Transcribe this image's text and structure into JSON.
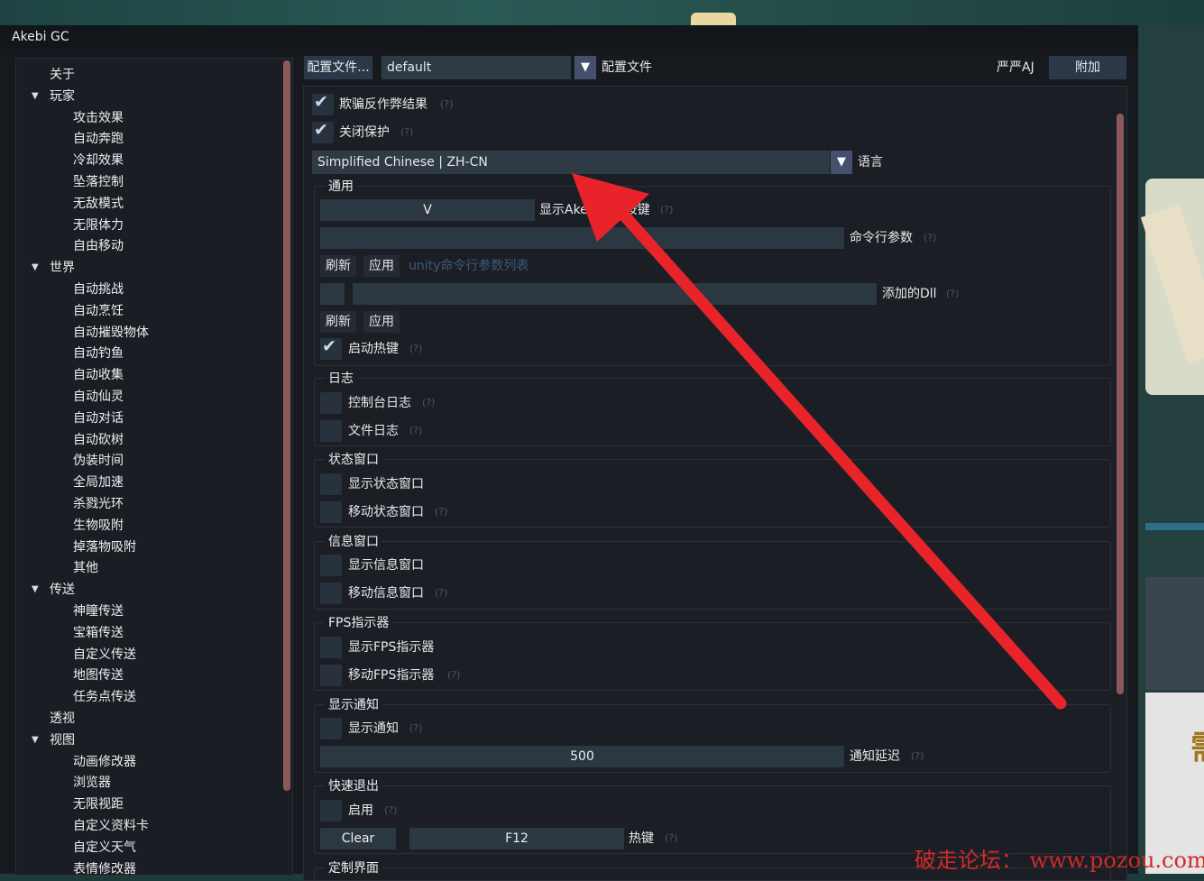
{
  "window": {
    "title": "Akebi GC"
  },
  "sidebar": {
    "items": [
      {
        "label": "关于",
        "level": 0,
        "expandable": false
      },
      {
        "label": "玩家",
        "level": 0,
        "expandable": true
      },
      {
        "label": "攻击效果",
        "level": 1
      },
      {
        "label": "自动奔跑",
        "level": 1
      },
      {
        "label": "冷却效果",
        "level": 1
      },
      {
        "label": "坠落控制",
        "level": 1
      },
      {
        "label": "无敌模式",
        "level": 1
      },
      {
        "label": "无限体力",
        "level": 1
      },
      {
        "label": "自由移动",
        "level": 1
      },
      {
        "label": "世界",
        "level": 0,
        "expandable": true
      },
      {
        "label": "自动挑战",
        "level": 1
      },
      {
        "label": "自动烹饪",
        "level": 1
      },
      {
        "label": "自动摧毁物体",
        "level": 1
      },
      {
        "label": "自动钓鱼",
        "level": 1
      },
      {
        "label": "自动收集",
        "level": 1
      },
      {
        "label": "自动仙灵",
        "level": 1
      },
      {
        "label": "自动对话",
        "level": 1
      },
      {
        "label": "自动砍树",
        "level": 1
      },
      {
        "label": "伪装时间",
        "level": 1
      },
      {
        "label": "全局加速",
        "level": 1
      },
      {
        "label": "杀戮光环",
        "level": 1
      },
      {
        "label": "生物吸附",
        "level": 1
      },
      {
        "label": "掉落物吸附",
        "level": 1
      },
      {
        "label": "其他",
        "level": 1
      },
      {
        "label": "传送",
        "level": 0,
        "expandable": true
      },
      {
        "label": "神瞳传送",
        "level": 1
      },
      {
        "label": "宝箱传送",
        "level": 1
      },
      {
        "label": "自定义传送",
        "level": 1
      },
      {
        "label": "地图传送",
        "level": 1
      },
      {
        "label": "任务点传送",
        "level": 1
      },
      {
        "label": "透视",
        "level": 0,
        "expandable": false
      },
      {
        "label": "视图",
        "level": 0,
        "expandable": true
      },
      {
        "label": "动画修改器",
        "level": 1
      },
      {
        "label": "浏览器",
        "level": 1
      },
      {
        "label": "无限视距",
        "level": 1
      },
      {
        "label": "自定义资料卡",
        "level": 1
      },
      {
        "label": "自定义天气",
        "level": 1
      },
      {
        "label": "表情修改器",
        "level": 1
      }
    ]
  },
  "toolbar": {
    "profile_button": "配置文件...",
    "profile_value": "default",
    "profile_label": "配置文件",
    "user_label": "严严AJ",
    "attach_button": "附加"
  },
  "settings": {
    "help": "(?)",
    "checked_mark": "✔",
    "arrow_glyph": "▼",
    "spoof_ac": {
      "label": "欺骗反作弊结果",
      "checked": true
    },
    "disable_protection": {
      "label": "关闭保护",
      "checked": true
    },
    "language": {
      "value": "Simplified Chinese | ZH-CN",
      "label": "语言"
    },
    "general": {
      "title": "通用",
      "hotkey_value": "V",
      "hotkey_label": "显示Akebi菜单按键",
      "cmdline_label": "命令行参数",
      "refresh": "刷新",
      "apply": "应用",
      "unity_hint": "unity命令行参数列表",
      "dll_label": "添加的Dll",
      "enable_hotkeys": {
        "label": "启动热键",
        "checked": true
      }
    },
    "logging": {
      "title": "日志",
      "console": "控制台日志",
      "file": "文件日志"
    },
    "status_window": {
      "title": "状态窗口",
      "show": "显示状态窗口",
      "move": "移动状态窗口"
    },
    "info_window": {
      "title": "信息窗口",
      "show": "显示信息窗口",
      "move": "移动信息窗口"
    },
    "fps": {
      "title": "FPS指示器",
      "show": "显示FPS指示器",
      "move": "移动FPS指示器"
    },
    "notifications": {
      "title": "显示通知",
      "show": "显示通知",
      "delay_value": "500",
      "delay_label": "通知延迟"
    },
    "fast_exit": {
      "title": "快速退出",
      "enable": "启用",
      "clear": "Clear",
      "key": "F12",
      "key_label": "热键"
    },
    "custom_ui": {
      "title": "定制界面"
    }
  },
  "watermark": "破走论坛： www.pozou.com",
  "colors": {
    "background": "#161a1f",
    "panel": "#1b1f25",
    "control": "#2c3841",
    "scrollbar": "#8a5a5a",
    "annotation_arrow": "#e8242a"
  }
}
